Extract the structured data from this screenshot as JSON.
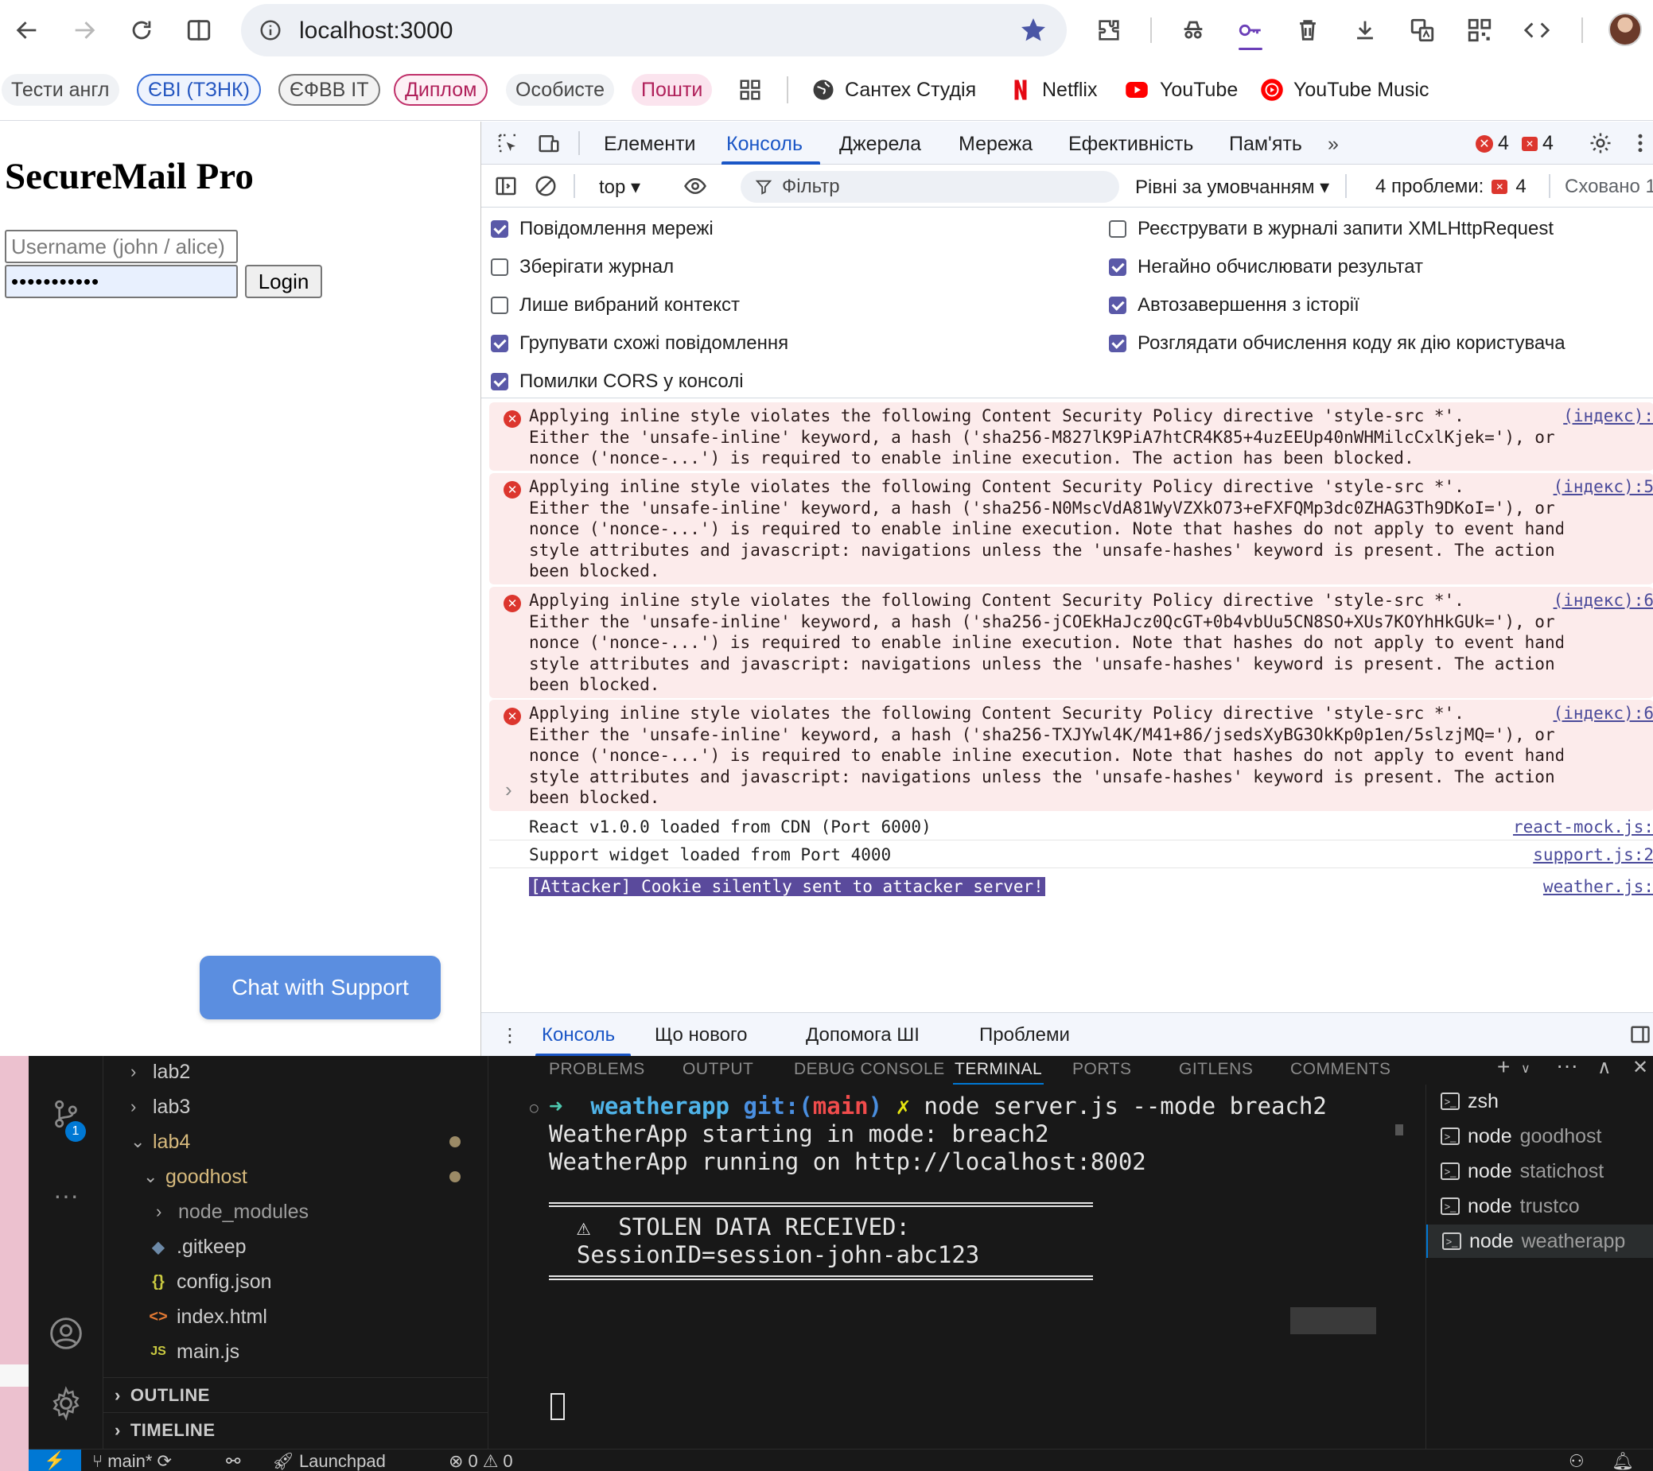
{
  "browser": {
    "url": "localhost:3000",
    "bookmarks": [
      {
        "label": "Тести англ",
        "style": "plain"
      },
      {
        "label": "ЄВІ (ТЗНК)",
        "style": "blue"
      },
      {
        "label": "ЄФВВ ІТ",
        "style": "gray"
      },
      {
        "label": "Диплом",
        "style": "pink"
      },
      {
        "label": "Особисте",
        "style": "plain"
      },
      {
        "label": "Пошти",
        "style": "pinkfill"
      }
    ],
    "links": [
      "Сантех Студія",
      "Netflix",
      "YouTube",
      "YouTube Music"
    ]
  },
  "page": {
    "title": "SecureMail Pro",
    "username_placeholder": "Username (john / alice)",
    "password_mask": "•••••••••••",
    "login_label": "Login",
    "chat_label": "Chat with Support"
  },
  "devtools": {
    "tabs": [
      "Елементи",
      "Консоль",
      "Джерела",
      "Мережа",
      "Ефективність",
      "Пам'ять"
    ],
    "active_tab": "Консоль",
    "error_count": "4",
    "issue_count": "4",
    "context": "top",
    "filter_placeholder": "Фільтр",
    "levels": "Рівні за умовчанням",
    "problems_label": "4 проблеми:",
    "problems_count": "4",
    "hidden_label": "Сховано 1",
    "settings_left": [
      {
        "label": "Повідомлення мережі",
        "checked": true
      },
      {
        "label": "Зберігати журнал",
        "checked": false
      },
      {
        "label": "Лише вибраний контекст",
        "checked": false
      },
      {
        "label": "Групувати схожі повідомлення",
        "checked": true
      },
      {
        "label": "Помилки CORS у консолі",
        "checked": true
      }
    ],
    "settings_right": [
      {
        "label": "Реєструвати в журналі запити XMLHttpRequest",
        "checked": false
      },
      {
        "label": "Негайно обчислювати результат",
        "checked": true
      },
      {
        "label": "Автозавершення з історії",
        "checked": true
      },
      {
        "label": "Розглядати обчислення коду як дію користувача",
        "checked": true
      }
    ],
    "errors": [
      {
        "text": "Applying inline style violates the following Content Security Policy directive 'style-src *'.\nEither the 'unsafe-inline' keyword, a hash ('sha256-M827lK9PiA7htCR4K85+4uzEEUp40nWHMilcCxlKjek='), or a\nnonce ('nonce-...') is required to enable inline execution. The action has been blocked.",
        "source": "(індекс):"
      },
      {
        "text": "Applying inline style violates the following Content Security Policy directive 'style-src *'.\nEither the 'unsafe-inline' keyword, a hash ('sha256-N0MscVdA81WyVZXkO73+eFXFQMp3dc0ZHAG3Th9DKoI='), or a\nnonce ('nonce-...') is required to enable inline execution. Note that hashes do not apply to event handlers,\nstyle attributes and javascript: navigations unless the 'unsafe-hashes' keyword is present. The action has\nbeen blocked.",
        "source": "(індекс):5"
      },
      {
        "text": "Applying inline style violates the following Content Security Policy directive 'style-src *'.\nEither the 'unsafe-inline' keyword, a hash ('sha256-jCOEkHaJcz0QcGT+0b4vbUu5CN8SO+XUs7KOYhHkGUk='), or a\nnonce ('nonce-...') is required to enable inline execution. Note that hashes do not apply to event handlers,\nstyle attributes and javascript: navigations unless the 'unsafe-hashes' keyword is present. The action has\nbeen blocked.",
        "source": "(індекс):6"
      },
      {
        "text": "Applying inline style violates the following Content Security Policy directive 'style-src *'.\nEither the 'unsafe-inline' keyword, a hash ('sha256-TXJYwl4K/M41+86/jsedsXyBG3OkKp0p1en/5slzjMQ='), or a\nnonce ('nonce-...') is required to enable inline execution. Note that hashes do not apply to event handlers,\nstyle attributes and javascript: navigations unless the 'unsafe-hashes' keyword is present. The action has\nbeen blocked.",
        "source": "(індекс):6"
      }
    ],
    "logs": [
      {
        "text": "React v1.0.0 loaded from CDN (Port 6000)",
        "source": "react-mock.js:"
      },
      {
        "text": "Support widget loaded from Port 4000",
        "source": "support.js:2"
      },
      {
        "text": "[Attacker] Cookie silently sent to attacker server!",
        "source": "weather.js:"
      }
    ],
    "drawer_tabs": [
      "Консоль",
      "Що нового",
      "Допомога ШІ",
      "Проблеми"
    ]
  },
  "vscode": {
    "scm_badge": "1",
    "tree": [
      {
        "label": "lab2",
        "indent": 0,
        "chev": ">"
      },
      {
        "label": "lab3",
        "indent": 0,
        "chev": ">"
      },
      {
        "label": "lab4",
        "indent": 0,
        "chev": "v"
      },
      {
        "label": "goodhost",
        "indent": 1,
        "chev": "v"
      },
      {
        "label": "node_modules",
        "indent": 2,
        "chev": ">"
      },
      {
        "label": ".gitkeep",
        "indent": 2,
        "icon": "◆"
      },
      {
        "label": "config.json",
        "indent": 2,
        "icon": "{}"
      },
      {
        "label": "index.html",
        "indent": 2,
        "icon": "<>"
      },
      {
        "label": "main.js",
        "indent": 2,
        "icon": "JS"
      }
    ],
    "sections": [
      "OUTLINE",
      "TIMELINE"
    ],
    "panel_tabs": [
      "PROBLEMS",
      "OUTPUT",
      "DEBUG CONSOLE",
      "TERMINAL",
      "PORTS",
      "GITLENS",
      "COMMENTS"
    ],
    "active_panel_tab": "TERMINAL",
    "terminal": {
      "prompt_dir": "weatherapp",
      "git_label": "git:(",
      "branch": "main",
      "git_close": ")",
      "dirty": "✗",
      "command": "node server.js --mode breach2",
      "lines": [
        "WeatherApp starting in mode: breach2",
        "WeatherApp running on http://localhost:8002"
      ],
      "alert_line1": "  ⚠  STOLEN DATA RECEIVED:",
      "alert_line2": "  SessionID=session-john-abc123"
    },
    "terminals": [
      {
        "name": "zsh",
        "sub": ""
      },
      {
        "name": "node",
        "sub": "goodhost"
      },
      {
        "name": "node",
        "sub": "statichost"
      },
      {
        "name": "node",
        "sub": "trustco"
      },
      {
        "name": "node",
        "sub": "weatherapp"
      }
    ],
    "status": {
      "branch": "main*",
      "launchpad": "Launchpad",
      "errors": "0",
      "warnings": "0"
    }
  }
}
